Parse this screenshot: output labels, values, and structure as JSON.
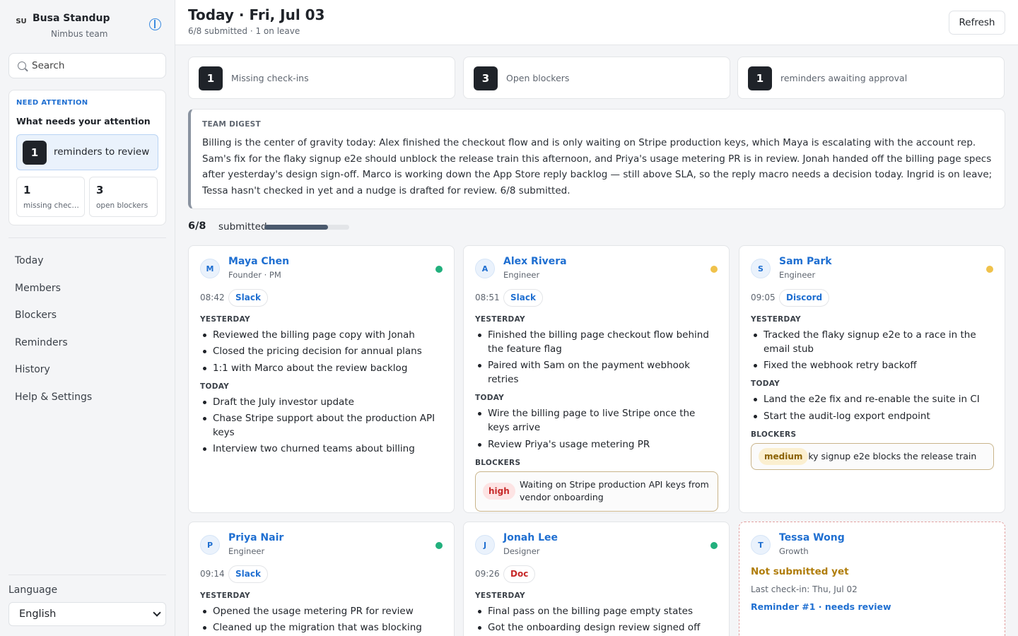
{
  "app": {
    "badge": "SU",
    "name": "Busa Standup",
    "team": "Nimbus team"
  },
  "search": {
    "placeholder": "Search"
  },
  "attention": {
    "kicker": "NEED ATTENTION",
    "title": "What needs your attention",
    "reminders_count": "1",
    "reminders_label": "reminders to review",
    "missing_count": "1",
    "missing_label": "missing check-ins",
    "blockers_count": "3",
    "blockers_label": "open blockers"
  },
  "nav": [
    "Today",
    "Members",
    "Blockers",
    "Reminders",
    "History",
    "Help & Settings"
  ],
  "language": {
    "label": "Language",
    "value": "English"
  },
  "header": {
    "title": "Today · Fri, Jul 03",
    "subtitle": "6/8 submitted · 1 on leave",
    "refresh": "Refresh"
  },
  "stats": [
    {
      "value": "1",
      "label": "Missing check-ins"
    },
    {
      "value": "3",
      "label": "Open blockers"
    },
    {
      "value": "1",
      "label": "reminders awaiting approval"
    }
  ],
  "digest": {
    "kicker": "TEAM DIGEST",
    "text": "Billing is the center of gravity today: Alex finished the checkout flow and is only waiting on Stripe production keys, which Maya is escalating with the account rep. Sam's fix for the flaky signup e2e should unblock the release train this afternoon, and Priya's usage metering PR is in review. Jonah handed off the billing page specs after yesterday's design sign-off. Marco is working down the App Store reply backlog — still above SLA, so the reply macro needs a decision today. Ingrid is on leave; Tessa hasn't checked in yet and a nudge is drafted for review. 6/8 submitted."
  },
  "progress": {
    "count": "6/8",
    "label": "submitted",
    "fraction": 0.75
  },
  "colors": {
    "accent": "#1f6fd1",
    "online": "#22b07d",
    "away": "#f0c24b",
    "high": "#c62828",
    "medium": "#8a6100",
    "pending": "#b07d0a"
  },
  "members": [
    {
      "initial": "M",
      "name": "Maya Chen",
      "role": "Founder · PM",
      "status": "online",
      "time": "08:42",
      "source": "Slack",
      "yesterday_label": "YESTERDAY",
      "yesterday": [
        "Reviewed the billing page copy with Jonah",
        "Closed the pricing decision for annual plans",
        "1:1 with Marco about the review backlog"
      ],
      "today_label": "TODAY",
      "today": [
        "Draft the July investor update",
        "Chase Stripe support about the production API keys",
        "Interview two churned teams about billing"
      ]
    },
    {
      "initial": "A",
      "name": "Alex Rivera",
      "role": "Engineer",
      "status": "away",
      "time": "08:51",
      "source": "Slack",
      "yesterday_label": "YESTERDAY",
      "yesterday": [
        "Finished the billing page checkout flow behind the feature flag",
        "Paired with Sam on the payment webhook retries"
      ],
      "today_label": "TODAY",
      "today": [
        "Wire the billing page to live Stripe once the keys arrive",
        "Review Priya's usage metering PR"
      ],
      "blockers_label": "BLOCKERS",
      "blocker": {
        "severity": "high",
        "text": "Waiting on Stripe production API keys from vendor onboarding"
      }
    },
    {
      "initial": "S",
      "name": "Sam Park",
      "role": "Engineer",
      "status": "away",
      "time": "09:05",
      "source": "Discord",
      "yesterday_label": "YESTERDAY",
      "yesterday": [
        "Tracked the flaky signup e2e to a race in the email stub",
        "Fixed the webhook retry backoff"
      ],
      "today_label": "TODAY",
      "today": [
        "Land the e2e fix and re-enable the suite in CI",
        "Start the audit-log export endpoint"
      ],
      "blockers_label": "BLOCKERS",
      "blocker": {
        "severity": "medium",
        "text": "Flaky signup e2e blocks the release train"
      }
    },
    {
      "initial": "P",
      "name": "Priya Nair",
      "role": "Engineer",
      "status": "online",
      "time": "09:14",
      "source": "Slack",
      "yesterday_label": "YESTERDAY",
      "yesterday": [
        "Opened the usage metering PR for review",
        "Cleaned up the migration that was blocking"
      ]
    },
    {
      "initial": "J",
      "name": "Jonah Lee",
      "role": "Designer",
      "status": "online",
      "time": "09:26",
      "source": "Doc",
      "yesterday_label": "YESTERDAY",
      "yesterday": [
        "Final pass on the billing page empty states",
        "Got the onboarding design review signed off"
      ]
    },
    {
      "initial": "T",
      "name": "Tessa Wong",
      "role": "Growth",
      "pending_title": "Not submitted yet",
      "last_checkin": "Last check-in: Thu, Jul 02",
      "reminder": "Reminder #1 · needs review"
    }
  ]
}
